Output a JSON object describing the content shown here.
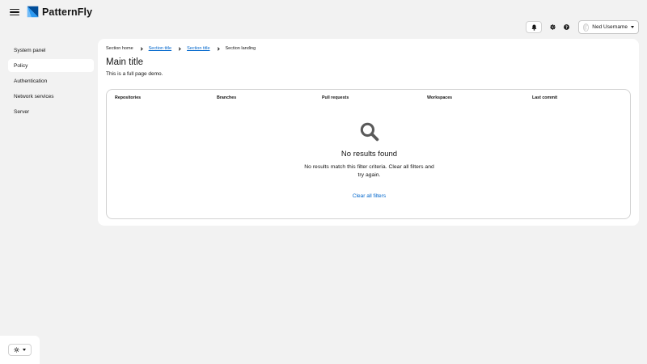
{
  "masthead": {
    "menu_icon": "hamburger-icon",
    "logo_text": "PatternFly",
    "logo_colors": {
      "dark": "#004d99",
      "light": "#2b9af3"
    },
    "tools": [
      {
        "name": "notifications",
        "icon": "bell-icon"
      },
      {
        "name": "settings",
        "icon": "gear-icon"
      },
      {
        "name": "help",
        "icon": "question-circle-icon"
      }
    ],
    "user": {
      "name": "Ned Username",
      "icon": "chevron-down-icon"
    }
  },
  "sidebar": {
    "items": [
      {
        "label": "System panel",
        "active": false
      },
      {
        "label": "Policy",
        "active": true
      },
      {
        "label": "Authentication",
        "active": false
      },
      {
        "label": "Network services",
        "active": false
      },
      {
        "label": "Server",
        "active": false
      }
    ],
    "theme_toggle": {
      "icon": "sun-icon"
    }
  },
  "main": {
    "breadcrumb": [
      {
        "label": "Section home",
        "link": false
      },
      {
        "label": "Section title",
        "link": true
      },
      {
        "label": "Section title",
        "link": true
      },
      {
        "label": "Section landing",
        "link": false
      }
    ],
    "title": "Main title",
    "description": "This is a full page demo.",
    "table": {
      "columns": [
        "Repositories",
        "Branches",
        "Pull requests",
        "Workspaces",
        "Last commit"
      ],
      "empty_state": {
        "icon": "search-icon",
        "title": "No results found",
        "body": "No results match this filter criteria. Clear all filters and try again.",
        "action": "Clear all filters"
      }
    }
  },
  "colors": {
    "link": "#0066cc",
    "background": "#f2f2f2",
    "surface": "#ffffff",
    "border": "#d2d2d2"
  }
}
